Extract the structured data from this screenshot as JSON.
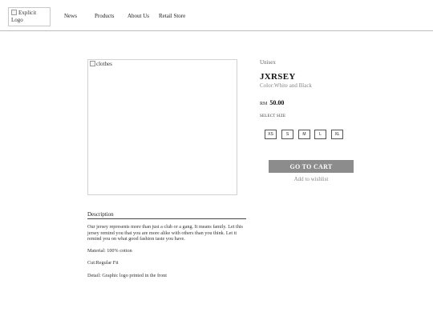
{
  "header": {
    "logo_alt": "Explicit Logo",
    "nav": [
      "News",
      "Products",
      "About Us",
      "Retail Store"
    ]
  },
  "product": {
    "image_alt": "clothes",
    "category": "Unisex",
    "title": "JXRSEY",
    "color": "Color:White and Black",
    "currency": "RM",
    "price": "50.00",
    "select_size_label": "SELECT SIZE",
    "sizes": [
      "XS",
      "S",
      "M",
      "L",
      "XL"
    ],
    "add_to_cart": "GO TO CART",
    "wishlist": "Add to wishlist"
  },
  "description": {
    "heading": "Description",
    "paragraphs": [
      "Our jersey represents more than just a club or a gang. It means family. Let this jersey remind you that you are more alike with others than you think. Let it remind you on what good fashion taste you have.",
      "Material: 100% cotton",
      "Cut:Regular Fit",
      "Detail: Graphic logo printed in the front"
    ]
  },
  "colors": {
    "cart_button": "#8c8c8c",
    "divider": "#bdbdbd"
  }
}
